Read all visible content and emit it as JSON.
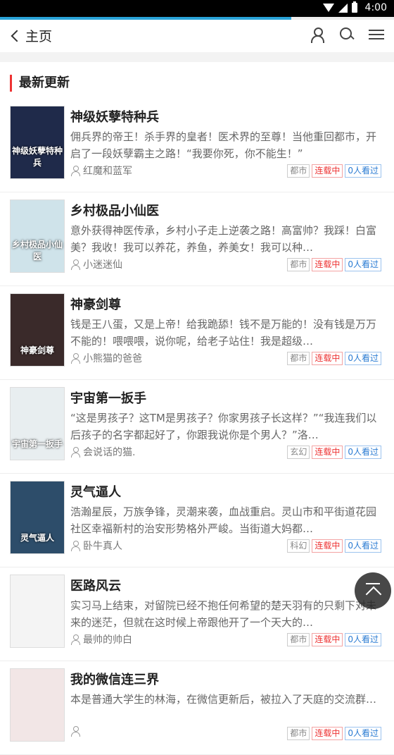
{
  "status_bar": {
    "time": "4:00"
  },
  "progress": {
    "fraction": 0.74
  },
  "header": {
    "back_label": "主页",
    "icons": [
      "user-icon",
      "search-icon",
      "menu-icon"
    ]
  },
  "section": {
    "title": "最新更新"
  },
  "books": [
    {
      "title": "神级妖孽特种兵",
      "desc": "佣兵界的帝王！杀手界的皇者！医术界的至尊！当他重回都市，开启了一段妖孽霸主之路！“我要你死，你不能生！”",
      "author": "红魔和蓝军",
      "category": "都市",
      "status": "连载中",
      "views": "0人看过",
      "cover_text": "神级妖孽特种兵",
      "cover_color": "#1f2a4a"
    },
    {
      "title": "乡村极品小仙医",
      "desc": "意外获得神医传承，乡村小子走上逆袭之路！高富帅？我踩！白富美？我收！我可以养花，养鱼，养美女！我可以种…",
      "author": "小迷迷仙",
      "category": "都市",
      "status": "连载中",
      "views": "0人看过",
      "cover_text": "乡村极品小仙医",
      "cover_color": "#cfe3ea"
    },
    {
      "title": "神豪剑尊",
      "desc": "钱是王八蛋，又是上帝！给我跪舔！钱不是万能的！没有钱是万万不能的！喂喂喂，说你呢，给老子站住！我是超级…",
      "author": "小熊猫的爸爸",
      "category": "都市",
      "status": "连载中",
      "views": "0人看过",
      "cover_text": "神豪剑尊",
      "cover_color": "#3a2a2a"
    },
    {
      "title": "宇宙第一扳手",
      "desc": "“这是男孩子？这TM是男孩子？你家男孩子长这样？”“我连我们以后孩子的名字都起好了，你跟我说你是个男人？”洛…",
      "author": "会说话的猫.",
      "category": "玄幻",
      "status": "连载中",
      "views": "0人看过",
      "cover_text": "宇宙第一扳手",
      "cover_color": "#e8eef0"
    },
    {
      "title": "灵气逼人",
      "desc": "浩瀚星辰，万族争锋，灵潮来袭，血战重启。灵山市和平街道花园社区幸福新村的治安形势格外严峻。当街道大妈都…",
      "author": "卧牛真人",
      "category": "科幻",
      "status": "连载中",
      "views": "0人看过",
      "cover_text": "灵气逼人",
      "cover_color": "#2d4d6a"
    },
    {
      "title": "医路风云",
      "desc": "实习马上结束，对留院已经不抱任何希望的楚天羽有的只剩下对未来的迷茫，但就在这时候上帝跟他开了一个天大的…",
      "author": "最帅的帅白",
      "category": "都市",
      "status": "连载中",
      "views": "0人看过",
      "cover_text": "",
      "cover_color": "#f4f4f4"
    },
    {
      "title": "我的微信连三界",
      "desc": "本是普通大学生的林海，在微信更新后，被拉入了天庭的交流群…",
      "author": "",
      "category": "都市",
      "status": "连载中",
      "views": "0人看过",
      "cover_text": "",
      "cover_color": "#f2e6e6"
    }
  ]
}
